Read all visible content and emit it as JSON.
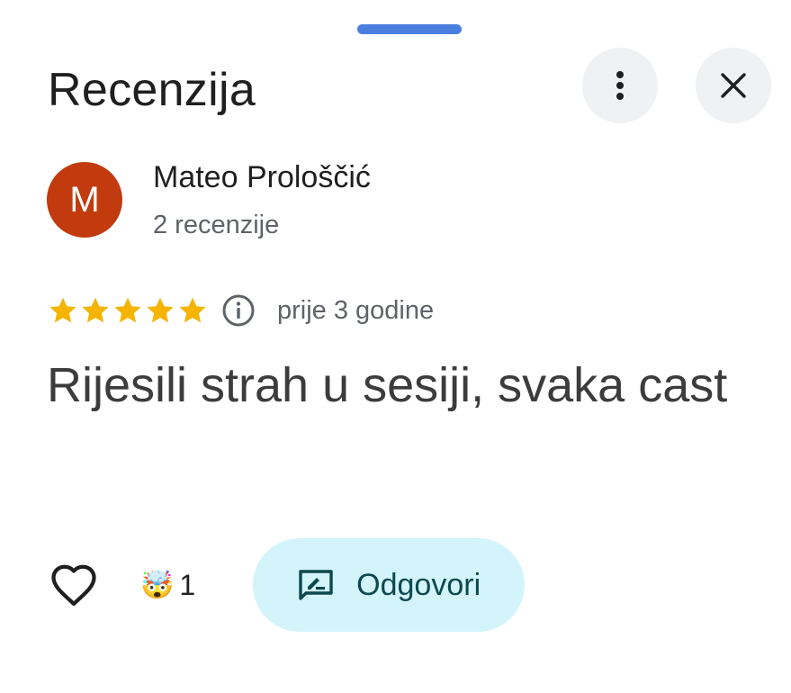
{
  "sheet": {
    "title": "Recenzija"
  },
  "header_buttons": {
    "more_icon": "more-vert-icon",
    "close_icon": "close-icon"
  },
  "author": {
    "initial": "M",
    "name": "Mateo Prološčić",
    "review_count": "2 recenzije",
    "avatar_color": "#c13b0e"
  },
  "review": {
    "rating": 5,
    "max_rating": 5,
    "star_color": "#f4b400",
    "time": "prije 3 godine",
    "text": "Rijesili strah u sesiji, svaka cast"
  },
  "actions": {
    "like_icon": "heart-outline-icon",
    "reaction_emoji": "🤯",
    "reaction_count": "1",
    "reply_label": "Odgovori",
    "reply_icon": "rate-review-icon",
    "reply_bg": "#d3f4fb"
  },
  "colors": {
    "accent": "#4a7fe0",
    "text_primary": "#1f1f1f",
    "text_secondary": "#5f6368",
    "reply_text": "#0c4850"
  }
}
